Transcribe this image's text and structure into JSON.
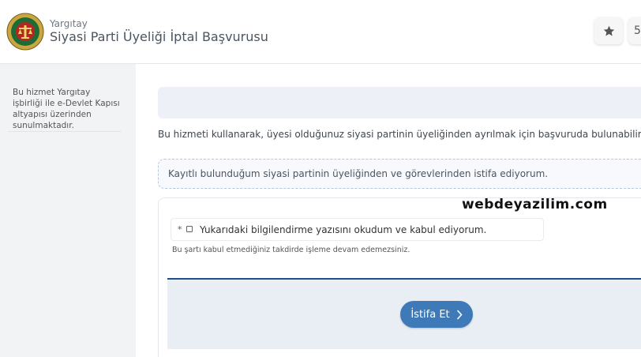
{
  "header": {
    "org": "Yargıtay",
    "title": "Siyasi Parti Üyeliği İptal Başvurusu",
    "fav_icon": "star-icon",
    "cut_fragment": "5"
  },
  "sidebar": {
    "text": "Bu hizmet Yargıtay işbirliği ile e-Devlet Kapısı altyapısı üzerinden sunulmaktadır."
  },
  "main": {
    "intro": "Bu hizmeti kullanarak, üyesi olduğunuz siyasi partinin üyeliğinden ayrılmak için başvuruda bulunabilirsiniz.",
    "declaration": "Kayıtlı bulunduğum siyasi partinin üyeliğinden ve görevlerinden istifa ediyorum.",
    "required_mark": "*",
    "checkbox_label": "Yukarıdaki bilgilendirme yazısını okudum ve kabul ediyorum.",
    "checkbox_checked": false,
    "checkbox_note": "Bu şartı kabul etmediğiniz takdirde işleme devam edemezsiniz.",
    "submit_label": "İstifa Et"
  },
  "watermark": "webdeyazilim.com",
  "colors": {
    "primary": "#3e7ab8",
    "divider": "#1f4e8c",
    "sidebar_bg": "#f2f3f5",
    "panel_bg": "#e9eef5"
  }
}
